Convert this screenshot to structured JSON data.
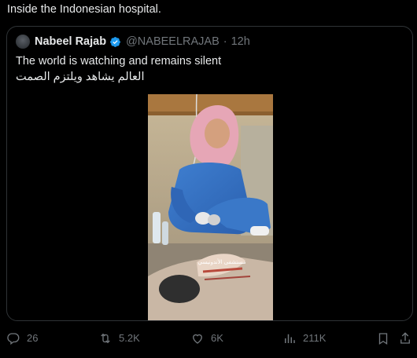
{
  "post": {
    "text": "Inside the Indonesian hospital."
  },
  "quote": {
    "name": "Nabeel Rajab",
    "handle": "@NABEELRAJAB",
    "separator": "·",
    "time": "12h",
    "text_en": "The world is watching and remains silent",
    "text_ar": "العالم يشاهد ويلتزم الصمت",
    "media_caption": "مستشفى الأندونيسي"
  },
  "actions": {
    "replies": "26",
    "reposts": "5.2K",
    "likes": "6K",
    "views": "211K"
  },
  "colors": {
    "background": "#000000",
    "text": "#e7e9ea",
    "muted": "#71767b",
    "border": "#2f3336",
    "verified": "#1d9bf0"
  },
  "icons": [
    "reply-icon",
    "repost-icon",
    "like-icon",
    "views-icon",
    "bookmark-icon",
    "share-icon",
    "verified-badge-icon"
  ]
}
